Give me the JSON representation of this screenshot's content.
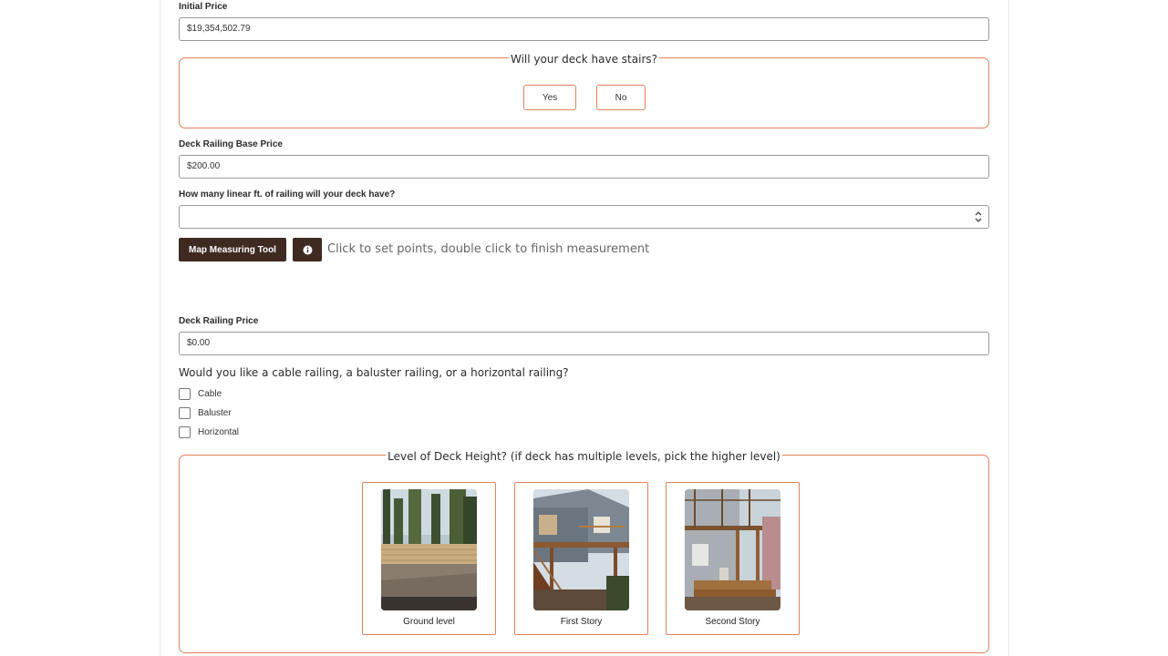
{
  "initial_price": {
    "label": "Initial Price",
    "value": "$19,354,502.79"
  },
  "stairs": {
    "legend": "Will your deck have stairs?",
    "yes_label": "Yes",
    "no_label": "No"
  },
  "railing_base_price": {
    "label": "Deck Railing Base Price",
    "value": "$200.00"
  },
  "linear_ft": {
    "label": "How many linear ft. of railing will your deck have?",
    "value": ""
  },
  "map_tool": {
    "button_label": "Map Measuring Tool",
    "info_icon": "info-icon",
    "hint": "Click to set points, double click to finish measurement"
  },
  "railing_price": {
    "label": "Deck Railing Price",
    "value": "$0.00"
  },
  "railing_type": {
    "question": "Would you like a cable railing, a baluster railing, or a horizontal railing?",
    "options": [
      "Cable",
      "Baluster",
      "Horizontal"
    ]
  },
  "deck_height": {
    "legend": "Level of Deck Height? (if deck has multiple levels, pick the higher level)",
    "options": [
      "Ground level",
      "First Story",
      "Second Story"
    ]
  },
  "colors": {
    "accent": "#e3825c",
    "dark_button": "#3f2a22"
  }
}
